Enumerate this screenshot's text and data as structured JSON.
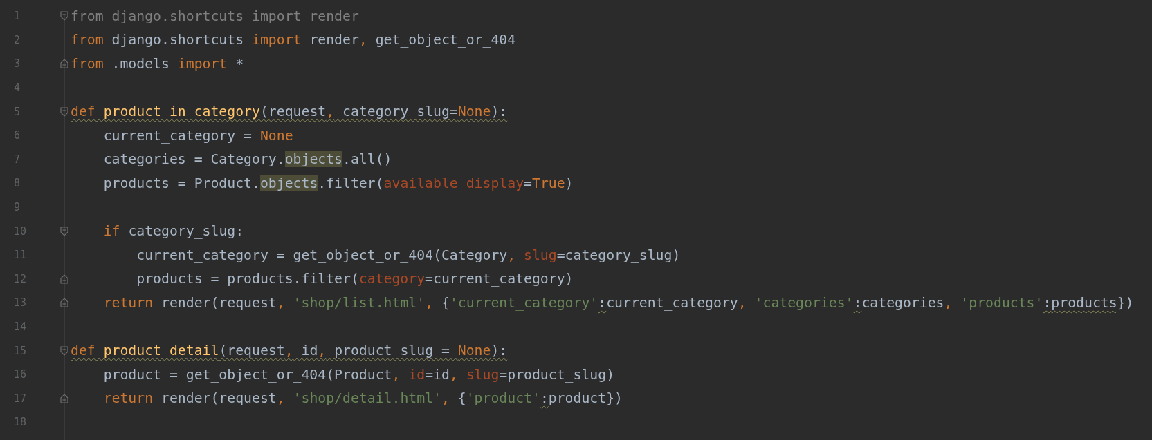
{
  "editor": {
    "lines": [
      {
        "number": "1",
        "kind": "opener",
        "tokens": [
          {
            "text": "from django.shortcuts import render",
            "kind": "dim",
            "warn": false
          }
        ]
      },
      {
        "number": "2",
        "kind": "plain",
        "tokens": [
          {
            "text": "from",
            "kind": "kw",
            "warn": false
          },
          {
            "text": " django.shortcuts ",
            "kind": "plain",
            "warn": false
          },
          {
            "text": "import",
            "kind": "kw",
            "warn": false
          },
          {
            "text": " render",
            "kind": "plain",
            "warn": false
          },
          {
            "text": ",",
            "kind": "kw",
            "warn": false
          },
          {
            "text": " get_object_or_404",
            "kind": "plain",
            "warn": false
          }
        ]
      },
      {
        "number": "3",
        "kind": "closer",
        "tokens": [
          {
            "text": "from",
            "kind": "kw",
            "warn": false
          },
          {
            "text": " .models ",
            "kind": "plain",
            "warn": false
          },
          {
            "text": "import",
            "kind": "kw",
            "warn": false
          },
          {
            "text": " *",
            "kind": "plain",
            "warn": false
          }
        ]
      },
      {
        "number": "4",
        "kind": "plain"
      },
      {
        "number": "5",
        "kind": "opener",
        "tokens": [
          {
            "text": "def",
            "kind": "kw",
            "warn": true
          },
          {
            "text": " product_in_category",
            "kind": "fn",
            "warn": true
          },
          {
            "text": "(request",
            "kind": "plain",
            "warn": true
          },
          {
            "text": ",",
            "kind": "kw",
            "warn": true
          },
          {
            "text": " category_slug=",
            "kind": "plain",
            "warn": true
          },
          {
            "text": "None",
            "kind": "kw",
            "warn": true
          },
          {
            "text": "):",
            "kind": "plain",
            "warn": true
          }
        ]
      },
      {
        "number": "6",
        "kind": "plain",
        "tokens": [
          {
            "text": "    current_category = ",
            "kind": "plain",
            "warn": false
          },
          {
            "text": "None",
            "kind": "kw",
            "warn": false
          }
        ]
      },
      {
        "number": "7",
        "kind": "plain",
        "tokens": [
          {
            "text": "    categories = Category.",
            "kind": "plain",
            "warn": false
          },
          {
            "text": "objects",
            "kind": "usage",
            "warn": false
          },
          {
            "text": ".all()",
            "kind": "plain",
            "warn": false
          }
        ]
      },
      {
        "number": "8",
        "kind": "plain",
        "tokens": [
          {
            "text": "    products = Product.",
            "kind": "plain",
            "warn": false
          },
          {
            "text": "objects",
            "kind": "usage",
            "warn": false
          },
          {
            "text": ".filter(",
            "kind": "plain",
            "warn": false
          },
          {
            "text": "available_display",
            "kind": "param",
            "warn": false
          },
          {
            "text": "=",
            "kind": "plain",
            "warn": false
          },
          {
            "text": "True",
            "kind": "kw",
            "warn": false
          },
          {
            "text": ")",
            "kind": "plain",
            "warn": false
          }
        ]
      },
      {
        "number": "9",
        "kind": "plain"
      },
      {
        "number": "10",
        "kind": "opener",
        "tokens": [
          {
            "text": "    if",
            "kind": "kw",
            "warn": false
          },
          {
            "text": " category_slug:",
            "kind": "plain",
            "warn": false
          }
        ]
      },
      {
        "number": "11",
        "kind": "plain",
        "tokens": [
          {
            "text": "        current_category = get_object_or_404(Category",
            "kind": "plain",
            "warn": false
          },
          {
            "text": ",",
            "kind": "kw",
            "warn": false
          },
          {
            "text": " slug",
            "kind": "param",
            "warn": false
          },
          {
            "text": "=category_slug)",
            "kind": "plain",
            "warn": false
          }
        ]
      },
      {
        "number": "12",
        "kind": "closer",
        "tokens": [
          {
            "text": "        products = products.filter(",
            "kind": "plain",
            "warn": false
          },
          {
            "text": "category",
            "kind": "param",
            "warn": false
          },
          {
            "text": "=current_category)",
            "kind": "plain",
            "warn": false
          }
        ]
      },
      {
        "number": "13",
        "kind": "closer",
        "tokens": [
          {
            "text": "    return",
            "kind": "kw",
            "warn": false
          },
          {
            "text": " render(request",
            "kind": "plain",
            "warn": false
          },
          {
            "text": ",",
            "kind": "kw",
            "warn": false
          },
          {
            "text": " 'shop/list.html'",
            "kind": "str",
            "warn": false
          },
          {
            "text": ",",
            "kind": "kw",
            "warn": false
          },
          {
            "text": " {",
            "kind": "plain",
            "warn": false
          },
          {
            "text": "'current_category'",
            "kind": "str",
            "warn": false
          },
          {
            "text": ":",
            "kind": "plain",
            "warn": true
          },
          {
            "text": "current_category",
            "kind": "plain",
            "warn": false
          },
          {
            "text": ",",
            "kind": "kw",
            "warn": false
          },
          {
            "text": " 'categories'",
            "kind": "str",
            "warn": false
          },
          {
            "text": ":",
            "kind": "plain",
            "warn": true
          },
          {
            "text": "categories",
            "kind": "plain",
            "warn": false
          },
          {
            "text": ",",
            "kind": "kw",
            "warn": false
          },
          {
            "text": " 'products'",
            "kind": "str",
            "warn": false
          },
          {
            "text": ":",
            "kind": "plain",
            "warn": true
          },
          {
            "text": "products",
            "kind": "plain",
            "warn": true
          },
          {
            "text": "})",
            "kind": "plain",
            "warn": false
          }
        ]
      },
      {
        "number": "14",
        "kind": "plain"
      },
      {
        "number": "15",
        "kind": "opener",
        "tokens": [
          {
            "text": "def",
            "kind": "kw",
            "warn": true
          },
          {
            "text": " product_detail",
            "kind": "fn",
            "warn": true
          },
          {
            "text": "(request",
            "kind": "plain",
            "warn": true
          },
          {
            "text": ",",
            "kind": "kw",
            "warn": true
          },
          {
            "text": " id",
            "kind": "plain",
            "warn": true
          },
          {
            "text": ",",
            "kind": "kw",
            "warn": true
          },
          {
            "text": " product_slug = ",
            "kind": "plain",
            "warn": true
          },
          {
            "text": "None",
            "kind": "kw",
            "warn": true
          },
          {
            "text": "):",
            "kind": "plain",
            "warn": true
          }
        ]
      },
      {
        "number": "16",
        "kind": "plain",
        "tokens": [
          {
            "text": "    product = get_object_or_404(Product",
            "kind": "plain",
            "warn": false
          },
          {
            "text": ",",
            "kind": "kw",
            "warn": false
          },
          {
            "text": " id",
            "kind": "param",
            "warn": false
          },
          {
            "text": "=id",
            "kind": "plain",
            "warn": false
          },
          {
            "text": ",",
            "kind": "kw",
            "warn": false
          },
          {
            "text": " slug",
            "kind": "param",
            "warn": false
          },
          {
            "text": "=product_slug)",
            "kind": "plain",
            "warn": false
          }
        ]
      },
      {
        "number": "17",
        "kind": "closer",
        "tokens": [
          {
            "text": "    return",
            "kind": "kw",
            "warn": false
          },
          {
            "text": " render(request",
            "kind": "plain",
            "warn": false
          },
          {
            "text": ",",
            "kind": "kw",
            "warn": false
          },
          {
            "text": " 'shop/detail.html'",
            "kind": "str",
            "warn": false
          },
          {
            "text": ",",
            "kind": "kw",
            "warn": false
          },
          {
            "text": " {",
            "kind": "plain",
            "warn": false
          },
          {
            "text": "'product'",
            "kind": "str",
            "warn": false
          },
          {
            "text": ":",
            "kind": "plain",
            "warn": true
          },
          {
            "text": "product})",
            "kind": "plain",
            "warn": false
          }
        ]
      },
      {
        "number": "18",
        "kind": "plain"
      }
    ]
  }
}
